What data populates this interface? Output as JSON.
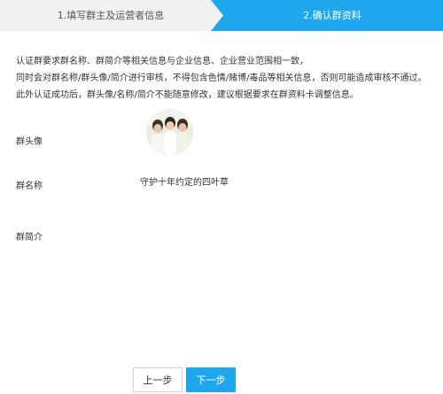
{
  "steps": {
    "step1_label": "1.填写群主及运营者信息",
    "step2_label": "2.确认群资料"
  },
  "notice": {
    "line1": "认证群要求群名称、群简介等相关信息与企业信息、企业营业范围相一致，",
    "line2": "同时会对群名称/群头像/简介进行审核，不得包含色情/赌博/毒品等相关信息，否则可能造成审核不通过。",
    "line3": "此外认证成功后，群头像/名称/简介不能随意修改，建议根据要求在群资料卡调整信息。"
  },
  "fields": {
    "avatar_label": "群头像",
    "name_label": "群名称",
    "name_value": "守护十年约定的四叶草",
    "intro_label": "群简介",
    "intro_value": ""
  },
  "buttons": {
    "prev": "上一步",
    "next": "下一步"
  },
  "colors": {
    "accent": "#1fa7ee"
  }
}
